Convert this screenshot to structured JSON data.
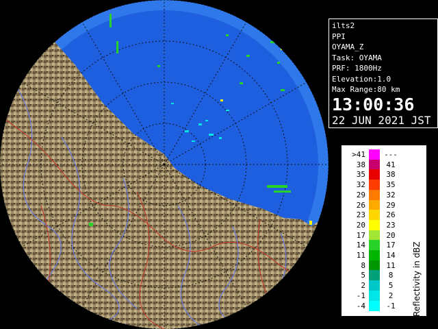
{
  "radar": {
    "site_name": "OYAMA",
    "colors": {
      "ocean": "#1e5fe0",
      "outside": "#000000",
      "range_ring": "#0a2f8c",
      "grid_line": "#1a1a1a",
      "river": "#6a7adf",
      "boundary": "#c0392b",
      "terrain_light": "#b8a67c",
      "terrain_dark": "#5a4a34"
    }
  },
  "info": {
    "lines": [
      "ilts2",
      "PPI",
      "OYAMA_Z",
      "Task: OYAMA",
      "PRF: 1800Hz",
      "Elevation:1.0",
      "Max Range:80 km"
    ],
    "time": "13:00:36",
    "date": "22 JUN 2021 JST"
  },
  "scale": {
    "unit_label": "Reflectivity in dBZ",
    "rows": [
      {
        "left": ">41",
        "right": "---",
        "color": "#ff00ff"
      },
      {
        "left": "38",
        "right": "41",
        "color": "#c8006e"
      },
      {
        "left": "35",
        "right": "38",
        "color": "#e60000"
      },
      {
        "left": "32",
        "right": "35",
        "color": "#ff3c00"
      },
      {
        "left": "29",
        "right": "32",
        "color": "#ff7a00"
      },
      {
        "left": "26",
        "right": "29",
        "color": "#ffaa00"
      },
      {
        "left": "23",
        "right": "26",
        "color": "#ffd700"
      },
      {
        "left": "20",
        "right": "23",
        "color": "#ffff00"
      },
      {
        "left": "17",
        "right": "20",
        "color": "#a0e632"
      },
      {
        "left": "14",
        "right": "17",
        "color": "#28d228"
      },
      {
        "left": "11",
        "right": "14",
        "color": "#00b400"
      },
      {
        "left": "8",
        "right": "11",
        "color": "#009600"
      },
      {
        "left": "5",
        "right": "8",
        "color": "#00a078"
      },
      {
        "left": "2",
        "right": "5",
        "color": "#00c8c8"
      },
      {
        "left": "-1",
        "right": "2",
        "color": "#00e6e6"
      },
      {
        "left": "-4",
        "right": "-1",
        "color": "#00ffff"
      }
    ]
  }
}
